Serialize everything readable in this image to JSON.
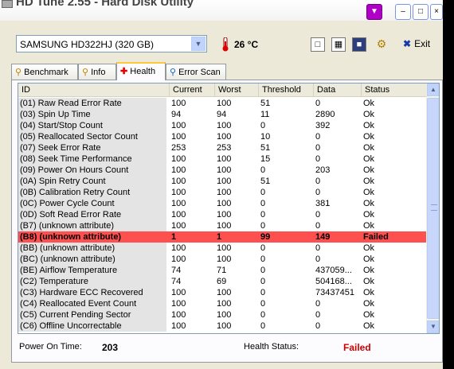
{
  "window": {
    "title": "HD Tune 2.55 - Hard Disk Utility"
  },
  "toolbar": {
    "drive": "SAMSUNG HD322HJ (320 GB)",
    "temperature": "26 °C",
    "exit_label": "Exit",
    "icons": [
      "copy-icon",
      "copy-screenshot-icon",
      "save-icon",
      "options-icon"
    ]
  },
  "tabs": [
    {
      "label": "Benchmark",
      "icon": "benchmark-icon"
    },
    {
      "label": "Info",
      "icon": "info-icon"
    },
    {
      "label": "Health",
      "icon": "health-icon",
      "active": true
    },
    {
      "label": "Error Scan",
      "icon": "error-scan-icon"
    }
  ],
  "columns": [
    "ID",
    "Current",
    "Worst",
    "Threshold",
    "Data",
    "Status"
  ],
  "rows": [
    {
      "id": "(01) Raw Read Error Rate",
      "current": "100",
      "worst": "100",
      "threshold": "51",
      "data": "0",
      "status": "Ok"
    },
    {
      "id": "(03) Spin Up Time",
      "current": "94",
      "worst": "94",
      "threshold": "11",
      "data": "2890",
      "status": "Ok"
    },
    {
      "id": "(04) Start/Stop Count",
      "current": "100",
      "worst": "100",
      "threshold": "0",
      "data": "392",
      "status": "Ok"
    },
    {
      "id": "(05) Reallocated Sector Count",
      "current": "100",
      "worst": "100",
      "threshold": "10",
      "data": "0",
      "status": "Ok"
    },
    {
      "id": "(07) Seek Error Rate",
      "current": "253",
      "worst": "253",
      "threshold": "51",
      "data": "0",
      "status": "Ok"
    },
    {
      "id": "(08) Seek Time Performance",
      "current": "100",
      "worst": "100",
      "threshold": "15",
      "data": "0",
      "status": "Ok"
    },
    {
      "id": "(09) Power On Hours Count",
      "current": "100",
      "worst": "100",
      "threshold": "0",
      "data": "203",
      "status": "Ok"
    },
    {
      "id": "(0A) Spin Retry Count",
      "current": "100",
      "worst": "100",
      "threshold": "51",
      "data": "0",
      "status": "Ok"
    },
    {
      "id": "(0B) Calibration Retry Count",
      "current": "100",
      "worst": "100",
      "threshold": "0",
      "data": "0",
      "status": "Ok"
    },
    {
      "id": "(0C) Power Cycle Count",
      "current": "100",
      "worst": "100",
      "threshold": "0",
      "data": "381",
      "status": "Ok"
    },
    {
      "id": "(0D) Soft Read Error Rate",
      "current": "100",
      "worst": "100",
      "threshold": "0",
      "data": "0",
      "status": "Ok"
    },
    {
      "id": "(B7) (unknown attribute)",
      "current": "100",
      "worst": "100",
      "threshold": "0",
      "data": "0",
      "status": "Ok"
    },
    {
      "id": "(B8) (unknown attribute)",
      "current": "1",
      "worst": "1",
      "threshold": "99",
      "data": "149",
      "status": "Failed",
      "failed": true
    },
    {
      "id": "(BB) (unknown attribute)",
      "current": "100",
      "worst": "100",
      "threshold": "0",
      "data": "0",
      "status": "Ok"
    },
    {
      "id": "(BC) (unknown attribute)",
      "current": "100",
      "worst": "100",
      "threshold": "0",
      "data": "0",
      "status": "Ok"
    },
    {
      "id": "(BE) Airflow Temperature",
      "current": "74",
      "worst": "71",
      "threshold": "0",
      "data": "437059...",
      "status": "Ok"
    },
    {
      "id": "(C2) Temperature",
      "current": "74",
      "worst": "69",
      "threshold": "0",
      "data": "504168...",
      "status": "Ok"
    },
    {
      "id": "(C3) Hardware ECC Recovered",
      "current": "100",
      "worst": "100",
      "threshold": "0",
      "data": "73437451",
      "status": "Ok"
    },
    {
      "id": "(C4) Reallocated Event Count",
      "current": "100",
      "worst": "100",
      "threshold": "0",
      "data": "0",
      "status": "Ok"
    },
    {
      "id": "(C5) Current Pending Sector",
      "current": "100",
      "worst": "100",
      "threshold": "0",
      "data": "0",
      "status": "Ok"
    },
    {
      "id": "(C6) Offline Uncorrectable",
      "current": "100",
      "worst": "100",
      "threshold": "0",
      "data": "0",
      "status": "Ok"
    }
  ],
  "status_bar": {
    "power_on_label": "Power On Time:",
    "power_on_value": "203",
    "health_label": "Health Status:",
    "health_value": "Failed"
  }
}
